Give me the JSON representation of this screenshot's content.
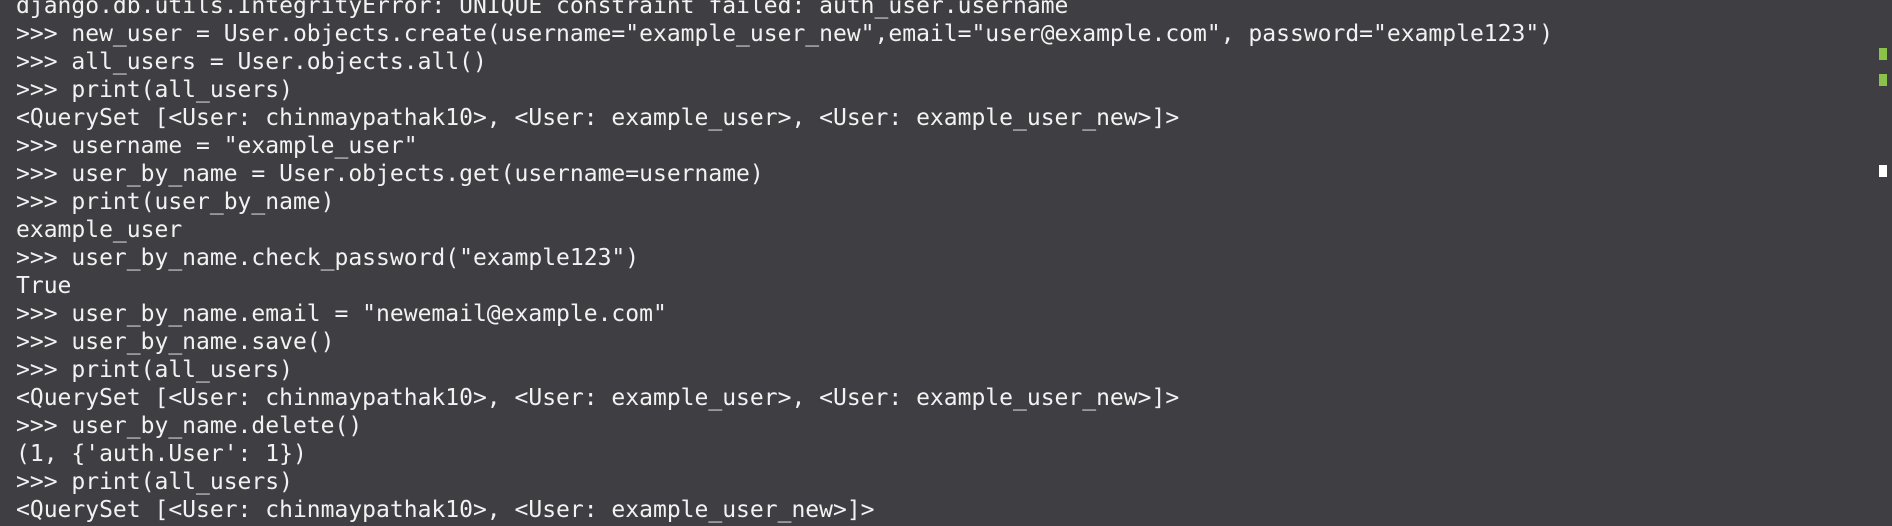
{
  "terminal": {
    "lines": [
      "django.db.utils.IntegrityError: UNIQUE constraint failed: auth_user.username",
      ">>> new_user = User.objects.create(username=\"example_user_new\",email=\"user@example.com\", password=\"example123\")",
      ">>> all_users = User.objects.all()",
      ">>> print(all_users)",
      "<QuerySet [<User: chinmaypathak10>, <User: example_user>, <User: example_user_new>]>",
      ">>> username = \"example_user\"",
      ">>> user_by_name = User.objects.get(username=username)",
      ">>> print(user_by_name)",
      "example_user",
      ">>> user_by_name.check_password(\"example123\")",
      "True",
      ">>> user_by_name.email = \"newemail@example.com\"",
      ">>> user_by_name.save()",
      ">>> print(all_users)",
      "<QuerySet [<User: chinmaypathak10>, <User: example_user>, <User: example_user_new>]>",
      ">>> user_by_name.delete()",
      "(1, {'auth.User': 1})",
      ">>> print(all_users)",
      "<QuerySet [<User: chinmaypathak10>, <User: example_user_new>]>"
    ],
    "prompt": ">>> "
  },
  "gutter": {
    "marks": [
      {
        "color": "#8bc34a",
        "name": "change-marker"
      },
      {
        "color": "#8bc34a",
        "name": "change-marker"
      },
      {
        "color": "#ffffff",
        "name": "scroll-position-marker"
      }
    ]
  },
  "colors": {
    "background": "#3f3e43",
    "text": "#f2f2f2",
    "accent_green": "#8bc34a"
  }
}
